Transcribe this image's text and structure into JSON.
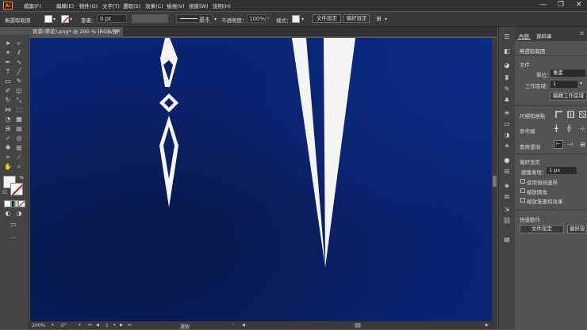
{
  "app": {
    "logo_text": "Ai"
  },
  "menu": [
    "檔案(F)",
    "編輯(E)",
    "物件(O)",
    "文字(T)",
    "選取(S)",
    "效果(C)",
    "檢視(V)",
    "視窗(W)",
    "說明(H)"
  ],
  "window_controls": [
    "—",
    "❐",
    "✕"
  ],
  "control_bar": {
    "selection_label": "無選取範圍",
    "stroke_weight_label": "筆畫：",
    "stroke_weight_value": "0 pt",
    "brush_label": "基本",
    "opacity_label": "不透明度：",
    "opacity_value": "100%",
    "style_label": "樣式：",
    "doc_setup_button": "文件設定",
    "preferences_button": "偏好設定"
  },
  "document_tab": {
    "title": "背景(帶花).png* @ 200 % (RGB/預覽)",
    "close": "✕"
  },
  "status_bar": {
    "zoom": "200%",
    "rotation": "0°",
    "page": "1",
    "tool_label": "選取"
  },
  "panel": {
    "tabs": [
      "內容",
      "資料庫"
    ],
    "no_selection": "無選取範圍",
    "document_section": "文件",
    "units_label": "單位：",
    "units_value": "像素",
    "artboard_label": "工作區域：",
    "artboard_value": "1",
    "edit_artboard_button": "編輯工作區域",
    "rulers_grids_section": "尺標和格點",
    "guides_label": "參考線",
    "snap_options_label": "靠齊選項",
    "preferences_section": "偏好設定",
    "keyboard_increment_label": "鍵盤漸增：",
    "keyboard_increment_value": "1 px",
    "checkboxes": [
      "使用預視邊界",
      "縮放圓角",
      "縮放筆畫和效果"
    ],
    "quick_actions_section": "快速動作",
    "doc_setup_button": "文件設定",
    "preferences_button": "偏好設定"
  },
  "colors": {
    "canvas_blue": "#0b2166",
    "shape_white": "#f5f5f5",
    "accent_orange": "#ff9a00"
  }
}
